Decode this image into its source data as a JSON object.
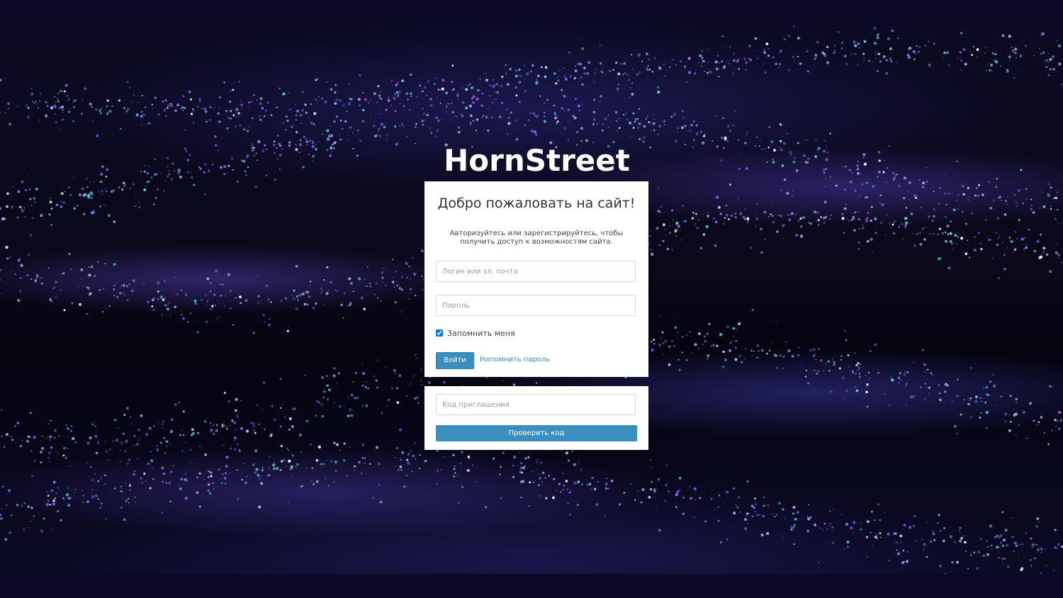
{
  "logo": {
    "text": "HornStreet"
  },
  "login": {
    "title": "Добро пожаловать на сайт!",
    "description": "Авторизуйтесь или зарегистрируйтесь, чтобы получить доступ к возможностям сайта.",
    "login_placeholder": "Логин или эл. почта",
    "login_value": "",
    "password_placeholder": "Пароль",
    "password_value": "",
    "remember_label": "Запомнить меня",
    "remember_checked": true,
    "submit_label": "Войти",
    "forgot_label": "Напомнить пароль"
  },
  "invite": {
    "code_placeholder": "Код приглашения",
    "code_value": "",
    "check_label": "Проверить код"
  },
  "colors": {
    "frame": "#0b0726",
    "accent": "#3a8fbf",
    "card": "#ffffff",
    "text": "#333333"
  }
}
